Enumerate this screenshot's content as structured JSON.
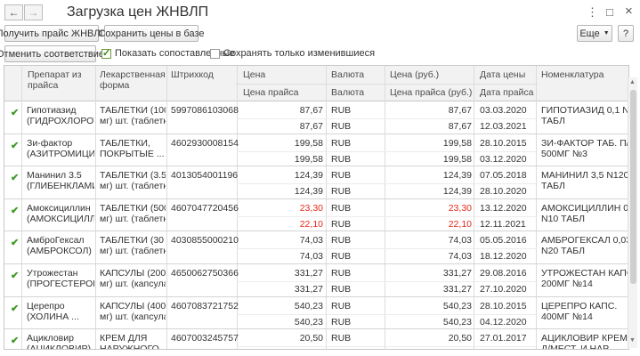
{
  "window": {
    "title": "Загрузка цен ЖНВЛП",
    "back_icon": "←",
    "forward_icon": "→",
    "menu_icon": "⋮",
    "maximize_icon": "□",
    "close_icon": "×"
  },
  "toolbar": {
    "get_price": "Получить прайс ЖНВЛП",
    "save_prices": "Сохранить цены в базе",
    "more": "Еще",
    "help": "?",
    "cancel_match": "Отменить соответствие",
    "show_matched": "Показать сопоставленные",
    "show_matched_checked": true,
    "save_changed": "Сохранять только изменившиеся",
    "save_changed_checked": false
  },
  "columns": {
    "drug": "Препарат из прайса",
    "form": "Лекарственная форма",
    "barcode": "Штрихкод",
    "price": "Цена",
    "price_list": "Цена прайса",
    "currency": "Валюта",
    "currency2": "Валюта",
    "price_rub": "Цена (руб.)",
    "price_list_rub": "Цена прайса (руб.)",
    "date": "Дата цены",
    "date2": "Дата прайса",
    "nomenclature": "Номенклатура"
  },
  "rows": [
    {
      "drug1": "Гипотиазид",
      "drug2": "(ГИДРОХЛОРОТИ",
      "form1": "ТАБЛЕТКИ (100",
      "form2": "мг) шт. (таблетка)",
      "barcode": "5997086103068",
      "price": "87,67",
      "price_list": "87,67",
      "cur": "RUB",
      "cur2": "RUB",
      "rub": "87,67",
      "rub2": "87,67",
      "date": "03.03.2020",
      "date2": "12.03.2021",
      "nom1": "ГИПОТИАЗИД 0,1 N20",
      "nom2": "ТАБЛ",
      "red": false
    },
    {
      "drug1": "Зи-фактор",
      "drug2": "(АЗИТРОМИЦИН)",
      "form1": "ТАБЛЕТКИ,",
      "form2": "ПОКРЫТЫЕ ...",
      "barcode": "4602930008154",
      "price": "199,58",
      "price_list": "199,58",
      "cur": "RUB",
      "cur2": "RUB",
      "rub": "199,58",
      "rub2": "199,58",
      "date": "28.10.2015",
      "date2": "03.12.2020",
      "nom1": "ЗИ-ФАКТОР ТАБ. П/О",
      "nom2": "500МГ №3",
      "red": false
    },
    {
      "drug1": "Манинил 3.5",
      "drug2": "(ГЛИБЕНКЛАМИД",
      "form1": "ТАБЛЕТКИ (3.5",
      "form2": "мг) шт. (таблетка)",
      "barcode": "4013054001196",
      "price": "124,39",
      "price_list": "124,39",
      "cur": "RUB",
      "cur2": "RUB",
      "rub": "124,39",
      "rub2": "124,39",
      "date": "07.05.2018",
      "date2": "28.10.2020",
      "nom1": "МАНИНИЛ 3,5 N120",
      "nom2": "ТАБЛ",
      "red": false
    },
    {
      "drug1": "Амоксициллин",
      "drug2": "(АМОКСИЦИЛЛИ",
      "form1": "ТАБЛЕТКИ (500",
      "form2": "мг) шт. (таблетка)",
      "barcode": "4607047720456",
      "price": "23,30",
      "price_list": "22,10",
      "cur": "RUB",
      "cur2": "RUB",
      "rub": "23,30",
      "rub2": "22,10",
      "date": "13.12.2020",
      "date2": "12.11.2021",
      "nom1": "АМОКСИЦИЛЛИН 0,5",
      "nom2": "N10 ТАБЛ",
      "red": true
    },
    {
      "drug1": "АмброГексал",
      "drug2": "(АМБРОКСОЛ)",
      "form1": "ТАБЛЕТКИ (30",
      "form2": "мг) шт. (таблетка)",
      "barcode": "4030855000210",
      "price": "74,03",
      "price_list": "74,03",
      "cur": "RUB",
      "cur2": "RUB",
      "rub": "74,03",
      "rub2": "74,03",
      "date": "05.05.2016",
      "date2": "18.12.2020",
      "nom1": "АМБРОГЕКСАЛ 0,03",
      "nom2": "N20 ТАБЛ",
      "red": false
    },
    {
      "drug1": "Утрожестан",
      "drug2": "(ПРОГЕСТЕРОН)",
      "form1": "КАПСУЛЫ (200",
      "form2": "мг) шт. (капсула)",
      "barcode": "4650062750366",
      "price": "331,27",
      "price_list": "331,27",
      "cur": "RUB",
      "cur2": "RUB",
      "rub": "331,27",
      "rub2": "331,27",
      "date": "29.08.2016",
      "date2": "27.10.2020",
      "nom1": "УТРОЖЕСТАН КАПС.",
      "nom2": "200МГ №14",
      "red": false
    },
    {
      "drug1": "Церепро",
      "drug2": "(ХОЛИНА ...",
      "form1": "КАПСУЛЫ (400",
      "form2": "мг) шт. (капсула)",
      "barcode": "4607083721752",
      "price": "540,23",
      "price_list": "540,23",
      "cur": "RUB",
      "cur2": "RUB",
      "rub": "540,23",
      "rub2": "540,23",
      "date": "28.10.2015",
      "date2": "04.12.2020",
      "nom1": "ЦЕРЕПРО КАПС.",
      "nom2": "400МГ №14",
      "red": false
    },
    {
      "drug1": "Ацикловир",
      "drug2": "(АЦИКЛОВИР)",
      "form1": "КРЕМ ДЛЯ",
      "form2": "НАРУЖНОГО",
      "barcode": "4607003245757",
      "price": "20,50",
      "price_list": "",
      "cur": "RUB",
      "cur2": "",
      "rub": "20,50",
      "rub2": "",
      "date": "27.01.2017",
      "date2": "",
      "nom1": "АЦИКЛОВИР КРЕМ",
      "nom2": "Д/МЕСТ. И НАР...",
      "red": false
    }
  ]
}
